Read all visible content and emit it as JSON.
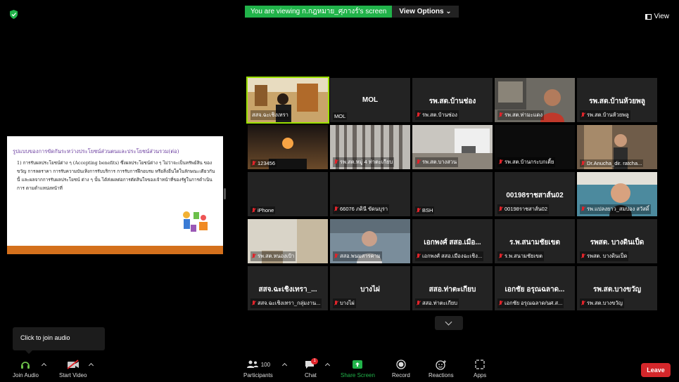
{
  "banner": {
    "viewing_text": "You are viewing ก.กฎหมาย_ศุภางร์'s screen",
    "view_options": "View Options"
  },
  "view_label": "View",
  "slide": {
    "title": "รูปแบบของการขัดกันระหว่างประโยชน์ส่วนตนและประโยชน์ส่วนรวม(ต่อ)",
    "body": "1) การรับผลประโยชน์ต่าง ๆ (Accepting benefits) ซึ่งผลประโยชน์ต่าง ๆ ไม่ว่าจะเป็นทรัพย์สิน ของขวัญ การลดราคา การรับความบันเทิงการรับบริการ การรับการฝึกอบรม หรือสิ่งอื่นใดในลักษณะเดียวกันนี้ และผลจากการรับผลประโยชน์ ต่าง ๆ นั้น ได้ส่งผลต่อการตัดสินใจของเจ้าหน้าที่ของรัฐในการดำเนินการ ตามตำแหน่งหน้าที่"
  },
  "participants": [
    {
      "name": "สสจ.ฉะเชิงเทรา",
      "big": "",
      "video": "room",
      "muted": false,
      "active": true
    },
    {
      "name": "MOL",
      "big": "MOL",
      "video": "",
      "muted": false,
      "active": false
    },
    {
      "name": "รพ.สต.บ้านช่อง",
      "big": "รพ.สต.บ้านช่อง",
      "video": "",
      "muted": true,
      "active": false
    },
    {
      "name": "รพ.สต.ท่ามะแดง",
      "big": "",
      "video": "person",
      "muted": true,
      "active": false
    },
    {
      "name": "รพ.สต.บ้านห้วยพลู",
      "big": "รพ.สต.บ้านห้วยพลู",
      "video": "",
      "muted": true,
      "active": false
    },
    {
      "name": "123456",
      "big": "",
      "video": "sunset",
      "muted": true,
      "active": false
    },
    {
      "name": "รพ.สต.หมู่ 4 ท่าตะเกียบ",
      "big": "",
      "video": "curtain",
      "muted": true,
      "active": false
    },
    {
      "name": "รพ.สต.บางสวน",
      "big": "",
      "video": "office",
      "muted": true,
      "active": false
    },
    {
      "name": "รพ.สต.บ้านกระบกเตี้ย",
      "big": "",
      "video": "dark",
      "muted": true,
      "active": false
    },
    {
      "name": "Dr.Anucha_dir. ratcha...",
      "big": "",
      "video": "door",
      "muted": true,
      "active": false
    },
    {
      "name": "iPhone",
      "big": "",
      "video": "",
      "muted": true,
      "active": false
    },
    {
      "name": "66076 ภดินี ขัดนบุรา",
      "big": "",
      "video": "",
      "muted": true,
      "active": false
    },
    {
      "name": "BSH",
      "big": "",
      "video": "",
      "muted": true,
      "active": false
    },
    {
      "name": "00198ราชสาส์น02",
      "big": "00198ราชสาส์น02",
      "video": "",
      "muted": true,
      "active": false
    },
    {
      "name": "รพ.แปลงยาว_สมปอง สวัสดิ์",
      "big": "",
      "video": "woman",
      "muted": true,
      "active": false
    },
    {
      "name": "รพ.สต.หนองเป้า",
      "big": "",
      "video": "wall",
      "muted": true,
      "active": false
    },
    {
      "name": "สสอ.พนมสารคาม",
      "big": "",
      "video": "man",
      "muted": true,
      "active": false
    },
    {
      "name": "เอกพงศ์ สสอ.เมืองฉะเชิง...",
      "big": "เอกพงศ์ สสอ.เมือ...",
      "video": "",
      "muted": true,
      "active": false
    },
    {
      "name": "ร.พ.สนามชัยเขต",
      "big": "ร.พ.สนามชัยเขต",
      "video": "",
      "muted": true,
      "active": false
    },
    {
      "name": "รพสต. บางดินเป็ด",
      "big": "รพสต. บางดินเป็ด",
      "video": "",
      "muted": true,
      "active": false
    },
    {
      "name": "สสจ.ฉะเชิงเทรา_กลุ่มงาน...",
      "big": "สสจ.ฉะเชิงเทรา_...",
      "video": "",
      "muted": true,
      "active": false
    },
    {
      "name": "บางไผ่",
      "big": "บางไผ่",
      "video": "",
      "muted": true,
      "active": false
    },
    {
      "name": "สสอ.ท่าตะเกียบ",
      "big": "สสอ.ท่าตะเกียบ",
      "video": "",
      "muted": true,
      "active": false
    },
    {
      "name": "เอกชัย อรุณฉลาด/นศ.ส...",
      "big": "เอกชัย อรุณฉลาด...",
      "video": "",
      "muted": true,
      "active": false
    },
    {
      "name": "รพ.สต.บางขวัญ",
      "big": "รพ.สต.บางขวัญ",
      "video": "",
      "muted": true,
      "active": false
    }
  ],
  "tooltip": "Click to join audio",
  "toolbar": {
    "join_audio": "Join Audio",
    "start_video": "Start Video",
    "participants": "Participants",
    "participants_count": "100",
    "chat": "Chat",
    "chat_badge": "1",
    "share_screen": "Share Screen",
    "record": "Record",
    "reactions": "Reactions",
    "apps": "Apps",
    "leave": "Leave"
  },
  "colors": {
    "banner_green": "#21b34a",
    "active_outline": "#9be000",
    "muted_red": "#e0242a",
    "leave_red": "#d4272b",
    "share_green": "#21b34a"
  }
}
